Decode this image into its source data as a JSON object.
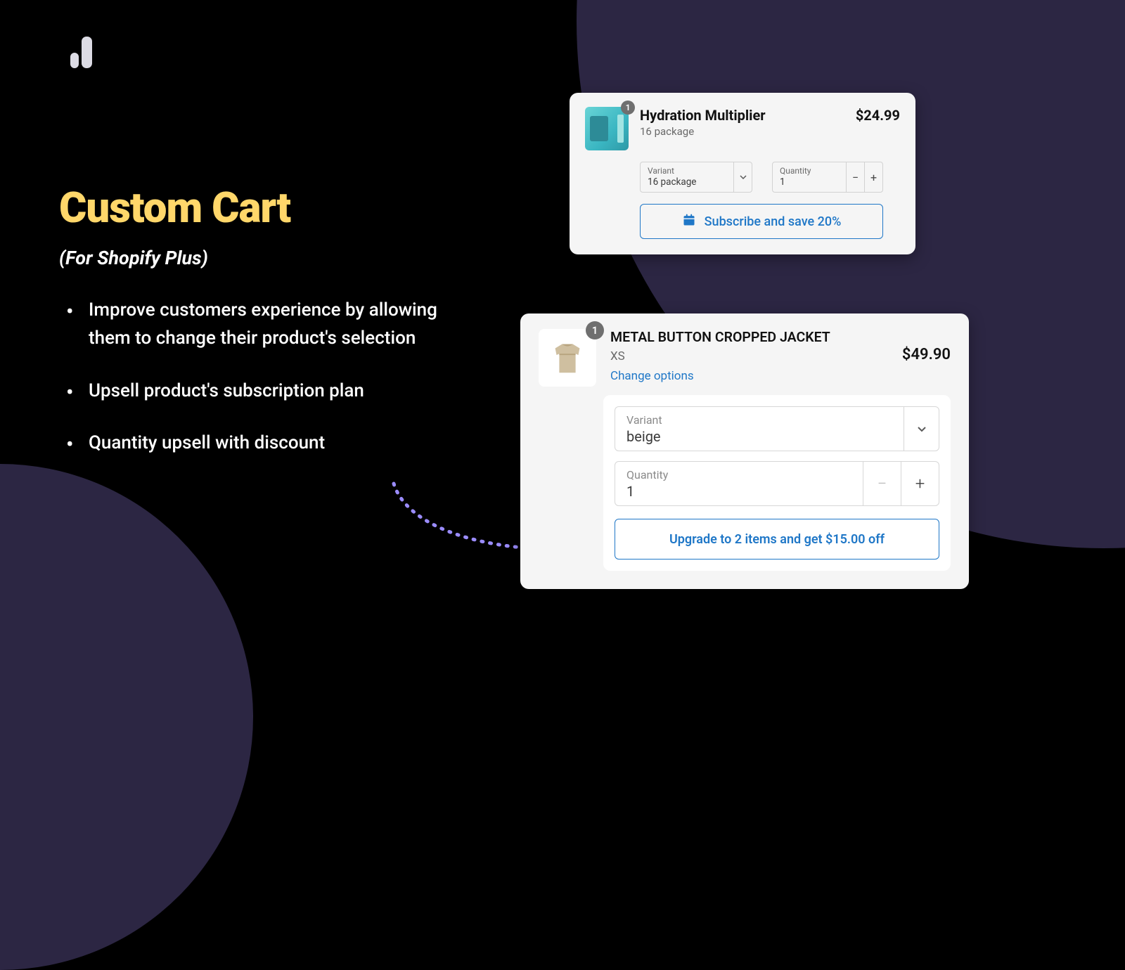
{
  "colors": {
    "accent": "#ffd76a",
    "link": "#1f77c7",
    "bg": "#000000",
    "arc": "#2c2643"
  },
  "left": {
    "title": "Custom Cart",
    "subtitle": "(For Shopify Plus)",
    "bullets": [
      "Improve customers experience by allowing them to change their product's selection",
      "Upsell product's subscription plan",
      "Quantity upsell with discount"
    ]
  },
  "cardA": {
    "badge": "1",
    "name": "Hydration Multiplier",
    "subtitle": "16 package",
    "price": "$24.99",
    "variant_label": "Variant",
    "variant_value": "16 package",
    "qty_label": "Quantity",
    "qty_value": "1",
    "subscribe_label": "Subscribe and save 20%"
  },
  "cardB": {
    "badge": "1",
    "name": "METAL BUTTON CROPPED JACKET",
    "subtitle": "XS",
    "price": "$49.90",
    "change_options": "Change options",
    "variant_label": "Variant",
    "variant_value": "beige",
    "qty_label": "Quantity",
    "qty_value": "1",
    "upgrade_label": "Upgrade to 2 items and get $15.00 off"
  }
}
